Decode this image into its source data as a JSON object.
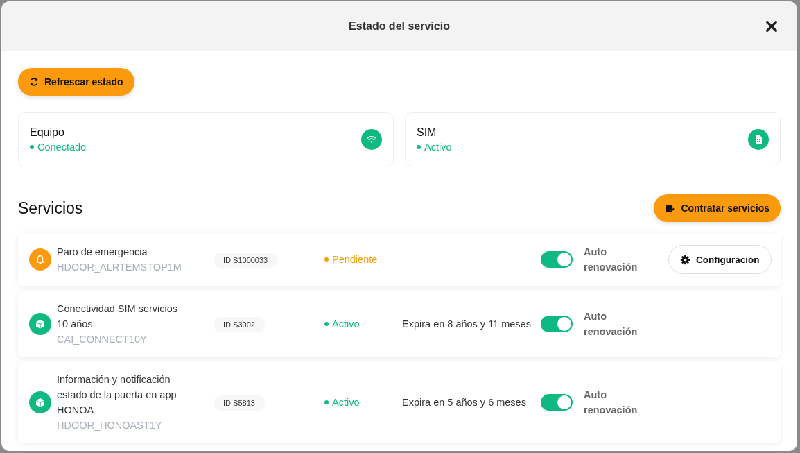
{
  "dialog": {
    "title": "Estado del servicio"
  },
  "refresh_button": {
    "label": "Refrescar estado"
  },
  "status_cards": [
    {
      "title": "Equipo",
      "status": "Conectado",
      "kind": "wifi"
    },
    {
      "title": "SIM",
      "status": "Activo",
      "kind": "sim"
    }
  ],
  "services_section": {
    "title": "Servicios",
    "action_button": {
      "label": "Contratar servicios"
    }
  },
  "services": [
    {
      "kind": "alert",
      "name": "Paro de emergencia",
      "code": "HDOOR_ALRTEMSTOP1M",
      "id": "ID S1000033",
      "status": "Pendiente",
      "color": "#f59e0b",
      "auto_renew": {
        "on": true,
        "label": "Auto renovación"
      },
      "config_button": "Configuración"
    },
    {
      "kind": "package",
      "name": "Conectividad SIM servicios 10 años",
      "code": "CAI_CONNECT10Y",
      "id": "ID S3002",
      "status": "Activo",
      "color": "#10b981",
      "expiry": "Expira en 8 años y 11 meses",
      "auto_renew": {
        "on": true,
        "label": "Auto renovación"
      }
    },
    {
      "kind": "package",
      "name": "Información y notificación estado de la puerta en app HONOA",
      "code": "HDOOR_HONOAST1Y",
      "id": "ID S5813",
      "status": "Activo",
      "color": "#10b981",
      "expiry": "Expira en 5 años y 6 meses",
      "auto_renew": {
        "on": true,
        "label": "Auto renovación"
      }
    }
  ]
}
